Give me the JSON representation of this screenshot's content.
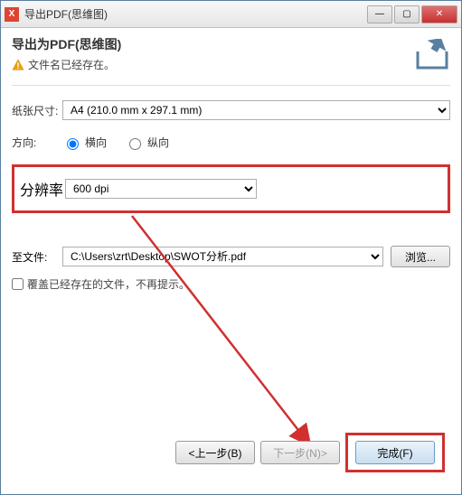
{
  "titlebar": {
    "title": "导出PDF(思维图)"
  },
  "heading": "导出为PDF(思维图)",
  "warning_text": "文件名已经存在。",
  "paper": {
    "label": "纸张尺寸:",
    "value": "A4 (210.0 mm x 297.1 mm)"
  },
  "orientation": {
    "label": "方向:",
    "landscape": "横向",
    "portrait": "纵向"
  },
  "resolution": {
    "label": "分辨率",
    "value": "600 dpi"
  },
  "file": {
    "label": "至文件:",
    "value": "C:\\Users\\zrt\\Desktop\\SWOT分析.pdf",
    "browse": "浏览..."
  },
  "overwrite_label": "覆盖已经存在的文件，不再提示。",
  "buttons": {
    "back": "<上一步(B)",
    "next": "下一步(N)>",
    "finish": "完成(F)"
  }
}
